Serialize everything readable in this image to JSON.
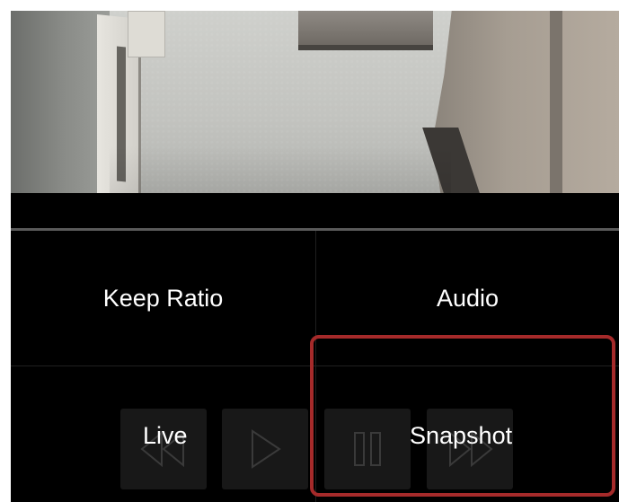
{
  "menu": {
    "keep_ratio_label": "Keep Ratio",
    "audio_label": "Audio",
    "live_label": "Live",
    "snapshot_label": "Snapshot"
  },
  "playback": {
    "controls": [
      {
        "icon": "rewind-icon"
      },
      {
        "icon": "play-icon"
      },
      {
        "icon": "pause-icon"
      },
      {
        "icon": "fast-forward-icon"
      }
    ]
  },
  "colors": {
    "background": "#000000",
    "text": "#ffffff",
    "control_bg": "#181818",
    "control_icon": "#3a3a3a",
    "highlight": "#a52a2a"
  }
}
